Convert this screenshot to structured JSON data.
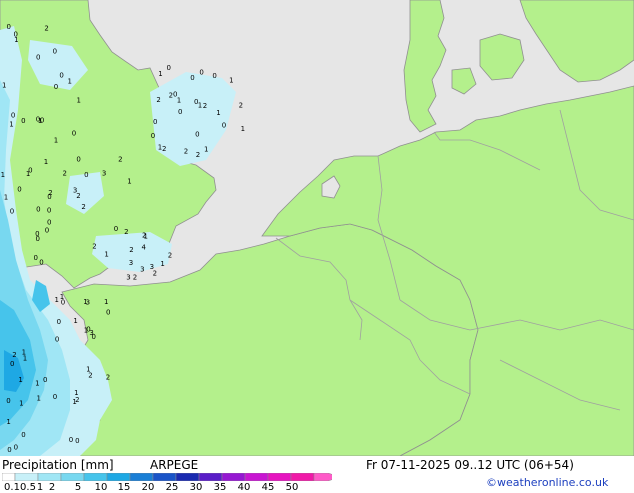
{
  "footer": {
    "title": "Precipitation [mm]",
    "model": "ARPEGE",
    "datetime": "Fr 07-11-2025 09..12 UTC (06+54)",
    "credit": "©weatheronline.co.uk"
  },
  "legend": {
    "labels": [
      "0.1",
      "0.5",
      "1",
      "2",
      "5",
      "10",
      "15",
      "20",
      "25",
      "30",
      "35",
      "40",
      "45",
      "50"
    ],
    "colors": [
      "#ffffff",
      "#c8f0f8",
      "#a0e6f5",
      "#78d8f0",
      "#46c4eb",
      "#1ea8e4",
      "#1a7fd6",
      "#1a54c8",
      "#1a2ab0",
      "#5a1ec8",
      "#9618d2",
      "#c816d2",
      "#e614c0",
      "#f01aa8",
      "#ff5ac8"
    ]
  },
  "colors": {
    "sea": "#e6e6e6",
    "land": "#b4f08c",
    "border": "#a0a0a0",
    "coast": "#909090"
  },
  "map_labels": {
    "cells": [
      "0",
      "1",
      "0",
      "0",
      "0",
      "1",
      "0",
      "0",
      "0",
      "0",
      "1",
      "0",
      "0",
      "1",
      "0",
      "1",
      "0",
      "0",
      "1",
      "2",
      "0",
      "1",
      "1",
      "1",
      "2",
      "0",
      "0",
      "0",
      "1",
      "1",
      "0",
      "0",
      "1",
      "0",
      "0",
      "0",
      "1",
      "0",
      "1",
      "1",
      "2",
      "1",
      "0",
      "0",
      "0",
      "1",
      "0",
      "0",
      "1",
      "0",
      "0",
      "0",
      "1",
      "0",
      "0",
      "1",
      "0",
      "0",
      "0",
      "1",
      "0",
      "0",
      "2",
      "0",
      "1",
      "0",
      "0",
      "0",
      "1",
      "0",
      "0",
      "2",
      "0",
      "1",
      "1",
      "1",
      "2",
      "0",
      "0",
      "1",
      "2",
      "2",
      "1",
      "1",
      "2",
      "2",
      "3",
      "2",
      "2",
      "3",
      "2",
      "2",
      "4",
      "3",
      "2",
      "1",
      "2",
      "3",
      "2",
      "1",
      "1",
      "0",
      "1",
      "2",
      "3",
      "2",
      "2",
      "3",
      "2",
      "0",
      "2",
      "1",
      "3",
      "1",
      "1",
      "1",
      "2",
      "0",
      "0",
      "3",
      "2",
      "1",
      "0",
      "1",
      "2",
      "0"
    ],
    "values_shown": [
      "0",
      "1",
      "2",
      "3",
      "4"
    ]
  }
}
